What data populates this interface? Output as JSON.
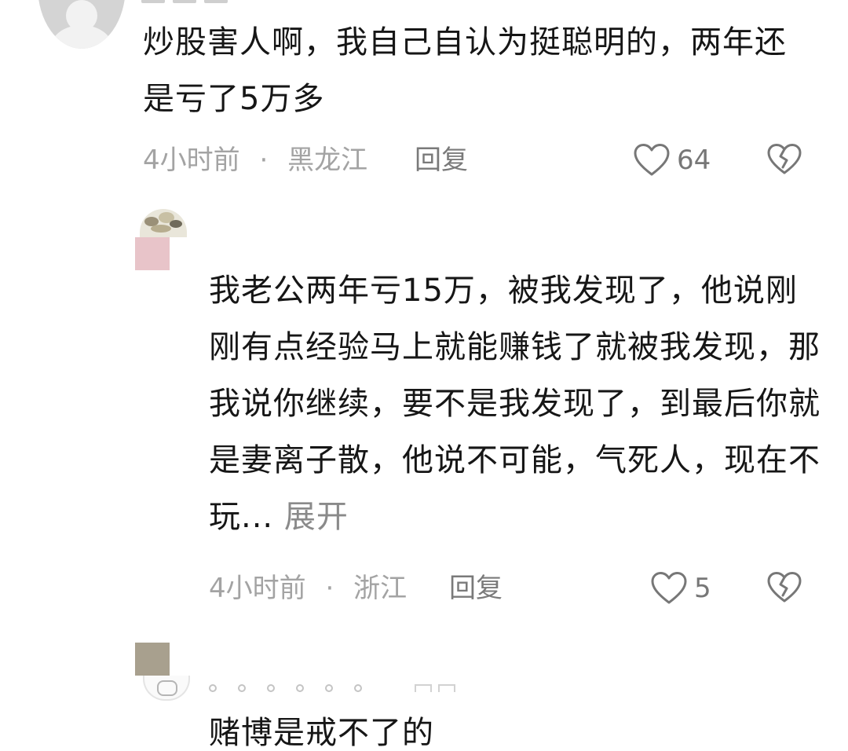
{
  "comments": [
    {
      "text": "炒股害人啊，我自己自认为挺聪明的，两年还是亏了5万多",
      "time": "4小时前",
      "separator": "·",
      "location": "黑龙江",
      "reply_label": "回复",
      "likes": "64",
      "like_icon": "heart-outline-icon",
      "dislike_icon": "broken-heart-icon"
    },
    {
      "text": "我老公两年亏15万，被我发现了，他说刚刚有点经验马上就能赚钱了就被我发现，那我说你继续，要不是我发现了，到最后你就是妻离子散，他说不可能，气死人，现在不玩...",
      "expand_label": "展开",
      "time": "4小时前",
      "separator": "·",
      "location": "浙江",
      "reply_label": "回复",
      "likes": "5",
      "like_icon": "heart-outline-icon",
      "dislike_icon": "broken-heart-icon"
    },
    {
      "text": "赌博是戒不了的"
    }
  ],
  "colors": {
    "text_primary": "#161616",
    "text_meta": "#a3a3a3",
    "text_reply": "#7a7a7a",
    "icon_stroke": "#777777",
    "avatar_mask_pink": "#e8c4c9",
    "avatar_mask_olive": "#a8a08e"
  }
}
